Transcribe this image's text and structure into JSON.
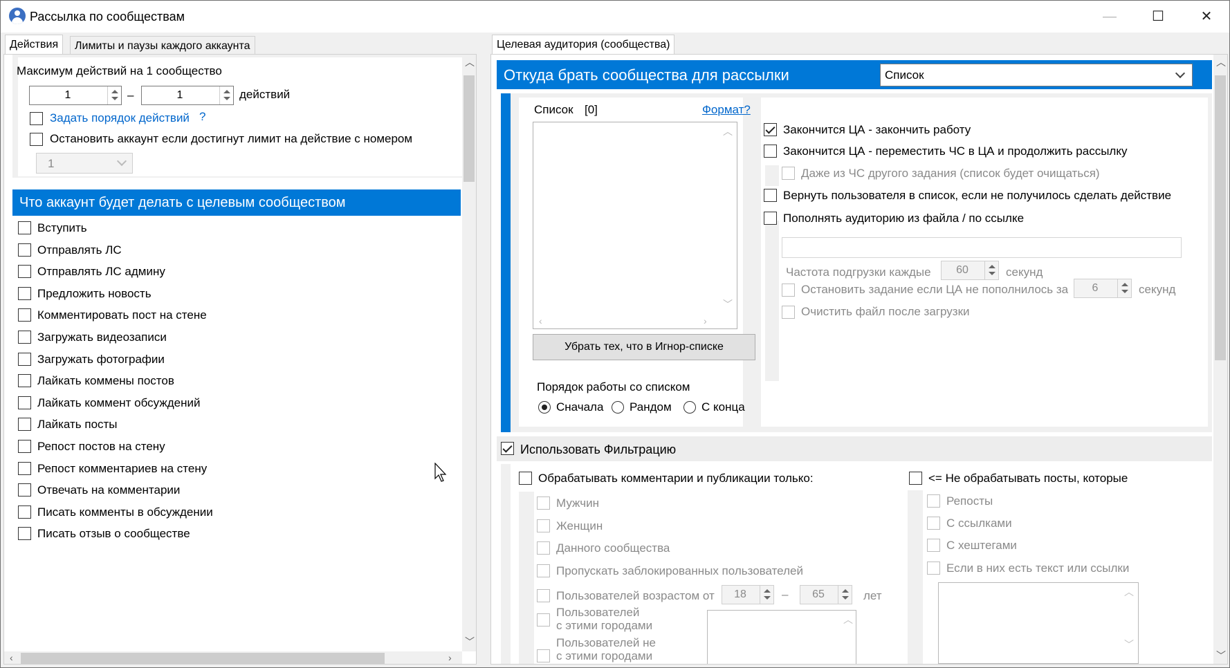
{
  "window": {
    "title": "Рассылка по сообществам",
    "icon": "user-avatar-icon",
    "minimize": "—",
    "maximize": "☐",
    "close": "✕"
  },
  "left_tabs": [
    {
      "label": "Действия",
      "active": true
    },
    {
      "label": "Лимиты и паузы каждого аккаунта",
      "active": false
    }
  ],
  "right_tabs": [
    {
      "label": "Целевая аудитория (сообщества)",
      "active": true
    }
  ],
  "max_actions": {
    "title": "Максимум действий на 1 сообщество",
    "from": "1",
    "dash": "–",
    "to": "1",
    "unit": "действий"
  },
  "order_actions": {
    "label": "Задать порядок действий",
    "help": "?",
    "checked": false
  },
  "stop_account": {
    "label": "Остановить аккаунт если достигнут лимит на действие с номером",
    "checked": false,
    "select_value": "1"
  },
  "actions_header": "Что аккаунт будет делать с целевым сообществом",
  "actions": [
    {
      "label": "Вступить",
      "checked": false
    },
    {
      "label": "Отправлять ЛС",
      "checked": false
    },
    {
      "label": "Отправлять ЛС админу",
      "checked": false
    },
    {
      "label": "Предложить новость",
      "checked": false
    },
    {
      "label": "Комментировать пост на стене",
      "checked": false
    },
    {
      "label": "Загружать видеозаписи",
      "checked": false
    },
    {
      "label": "Загружать фотографии",
      "checked": false
    },
    {
      "label": "Лайкать коммены постов",
      "checked": false
    },
    {
      "label": "Лайкать коммент обсуждений",
      "checked": false
    },
    {
      "label": "Лайкать посты",
      "checked": false
    },
    {
      "label": "Репост постов на стену",
      "checked": false
    },
    {
      "label": "Репост комментариев на стену",
      "checked": false
    },
    {
      "label": "Отвечать на комментарии",
      "checked": false
    },
    {
      "label": "Писать комменты в обсуждении",
      "checked": false
    },
    {
      "label": "Писать отзыв о сообществе",
      "checked": false
    }
  ],
  "source": {
    "header": "Откуда брать сообщества для рассылки",
    "select_value": "Список"
  },
  "list": {
    "label": "Список",
    "count": "[0]",
    "format_link": "Формат?",
    "remove_ignored_button": "Убрать тех, что в Игнор-списке",
    "order_label": "Порядок работы со списком",
    "order_options": [
      {
        "label": "Сначала",
        "selected": true
      },
      {
        "label": "Рандом",
        "selected": false
      },
      {
        "label": "С конца",
        "selected": false
      }
    ]
  },
  "options": [
    {
      "label": "Закончится ЦА - закончить работу",
      "checked": true,
      "disabled": false
    },
    {
      "label": "Закончится ЦА - переместить ЧС в ЦА и продолжить рассылку",
      "checked": false,
      "disabled": false
    },
    {
      "label": "Даже из ЧС другого задания (список будет очищаться)",
      "checked": false,
      "disabled": true
    },
    {
      "label": "Вернуть пользователя в список, если не получилось сделать действие",
      "checked": false,
      "disabled": false
    },
    {
      "label": "Пополнять аудиторию из файла / по ссылке",
      "checked": false,
      "disabled": false
    }
  ],
  "reload": {
    "freq_label": "Частота подгрузки каждые",
    "freq_value": "60",
    "freq_unit": "секунд",
    "stop_label": "Остановить задание если ЦА не пополнилось за",
    "stop_value": "6",
    "stop_unit": "секунд",
    "clear_label": "Очистить файл после загрузки"
  },
  "filtration": {
    "label": "Использовать Фильтрацию",
    "checked": true
  },
  "process_only": {
    "label": "Обрабатывать комментарии и публикации только:",
    "checked": false,
    "items": [
      "Мужчин",
      "Женщин",
      "Данного сообщества",
      "Пропускать заблокированных пользователей"
    ],
    "age_label": "Пользователей возрастом от",
    "age_from": "18",
    "age_dash": "–",
    "age_to": "65",
    "age_unit": "лет",
    "cities_with": [
      "Пользователей",
      "с этими городами"
    ],
    "cities_without": [
      "Пользователей не",
      "с этими городами"
    ]
  },
  "skip_posts": {
    "label": "<= Не обрабатывать посты, которые",
    "checked": false,
    "items": [
      "Репосты",
      "С ссылками",
      "С хештегами",
      "Если в них есть текст или ссылки"
    ]
  }
}
